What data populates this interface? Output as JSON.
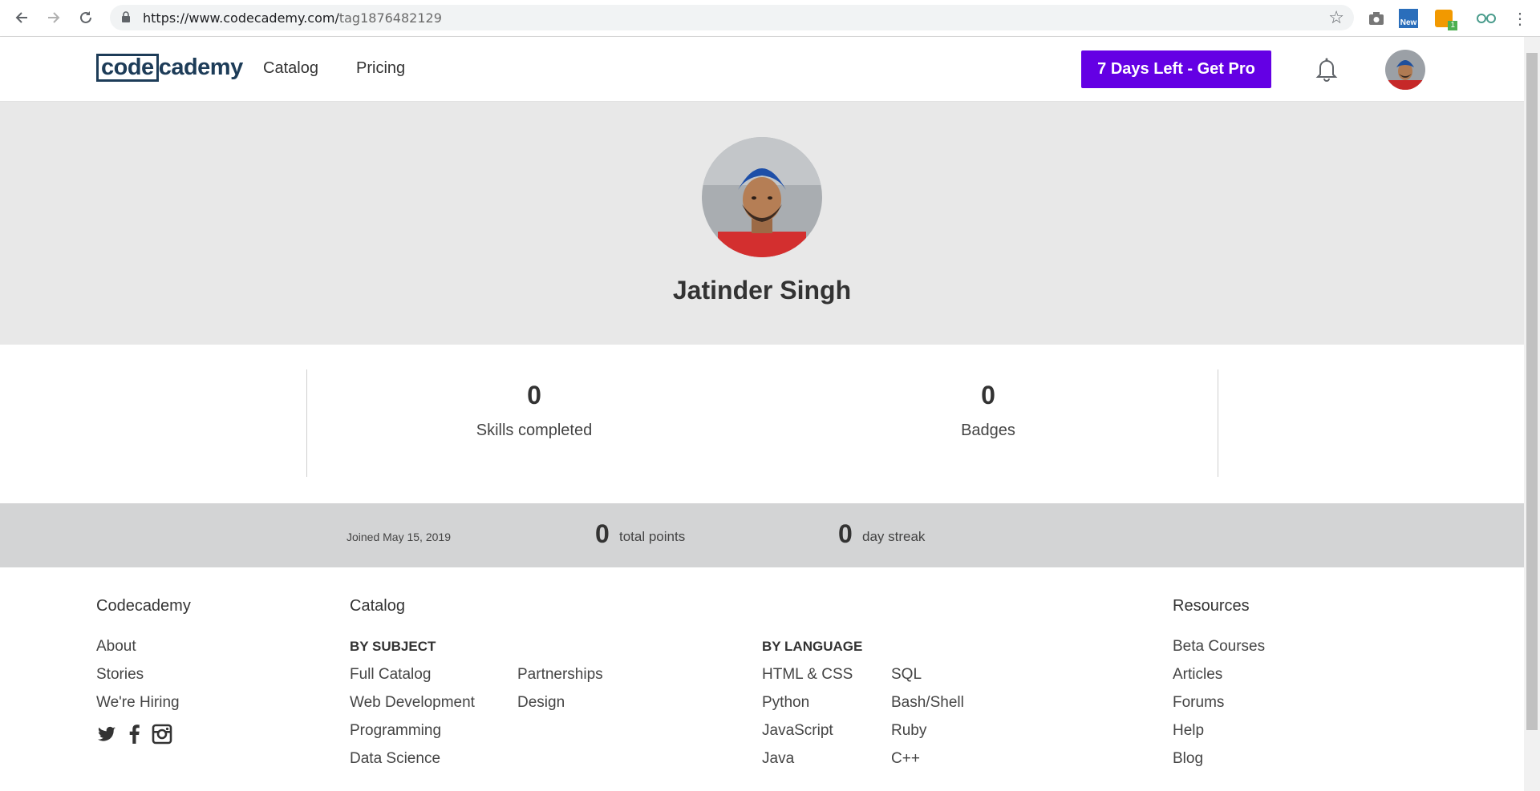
{
  "browser": {
    "url_host": "https://www.codecademy.com/",
    "url_path": "tag1876482129",
    "ext_new_label": "New",
    "ext_badge_count": "1"
  },
  "header": {
    "logo_boxed": "code",
    "logo_rest": "cademy",
    "nav": [
      "Catalog",
      "Pricing"
    ],
    "cta_label": "7 Days Left - Get Pro"
  },
  "profile": {
    "name": "Jatinder Singh"
  },
  "stats": {
    "skills_value": "0",
    "skills_label": "Skills completed",
    "badges_value": "0",
    "badges_label": "Badges"
  },
  "band": {
    "joined": "Joined May 15, 2019",
    "points_value": "0",
    "points_label": "total points",
    "streak_value": "0",
    "streak_label": "day streak"
  },
  "footer": {
    "codecademy": {
      "heading": "Codecademy",
      "links": [
        "About",
        "Stories",
        "We're Hiring"
      ]
    },
    "catalog": {
      "heading": "Catalog",
      "by_subject": "BY SUBJECT",
      "subject_col1": [
        "Full Catalog",
        "Web Development",
        "Programming",
        "Data Science"
      ],
      "subject_col2": [
        "Partnerships",
        "Design"
      ],
      "by_language": "BY LANGUAGE",
      "lang_col1": [
        "HTML & CSS",
        "Python",
        "JavaScript",
        "Java"
      ],
      "lang_col2": [
        "SQL",
        "Bash/Shell",
        "Ruby",
        "C++"
      ]
    },
    "resources": {
      "heading": "Resources",
      "links": [
        "Beta Courses",
        "Articles",
        "Forums",
        "Help",
        "Blog"
      ]
    }
  },
  "colors": {
    "cta": "#6400e4",
    "logo": "#1d3c58",
    "hero_bg": "#e8e8e8",
    "band_bg": "#d3d4d5"
  }
}
